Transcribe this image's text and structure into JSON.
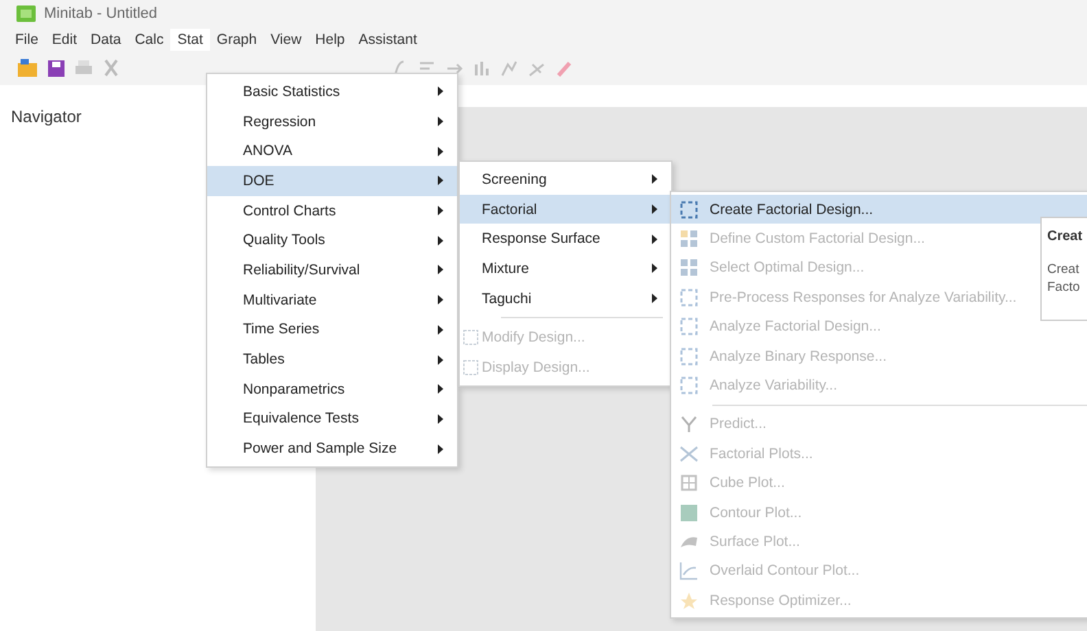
{
  "window": {
    "title": "Minitab - Untitled"
  },
  "menu_bar": [
    {
      "label": "File",
      "selected": false
    },
    {
      "label": "Edit",
      "selected": false
    },
    {
      "label": "Data",
      "selected": false
    },
    {
      "label": "Calc",
      "selected": false
    },
    {
      "label": "Stat",
      "selected": true
    },
    {
      "label": "Graph",
      "selected": false
    },
    {
      "label": "View",
      "selected": false
    },
    {
      "label": "Help",
      "selected": false
    },
    {
      "label": "Assistant",
      "selected": false
    }
  ],
  "navigator": {
    "title": "Navigator"
  },
  "stat_menu": [
    {
      "label": "Basic Statistics",
      "submenu": true,
      "selected": false
    },
    {
      "label": "Regression",
      "submenu": true,
      "selected": false
    },
    {
      "label": "ANOVA",
      "submenu": true,
      "selected": false
    },
    {
      "label": "DOE",
      "submenu": true,
      "selected": true
    },
    {
      "label": "Control Charts",
      "submenu": true,
      "selected": false
    },
    {
      "label": "Quality Tools",
      "submenu": true,
      "selected": false
    },
    {
      "label": "Reliability/Survival",
      "submenu": true,
      "selected": false
    },
    {
      "label": "Multivariate",
      "submenu": true,
      "selected": false
    },
    {
      "label": "Time Series",
      "submenu": true,
      "selected": false
    },
    {
      "label": "Tables",
      "submenu": true,
      "selected": false
    },
    {
      "label": "Nonparametrics",
      "submenu": true,
      "selected": false
    },
    {
      "label": "Equivalence Tests",
      "submenu": true,
      "selected": false
    },
    {
      "label": "Power and Sample Size",
      "submenu": true,
      "selected": false
    }
  ],
  "doe_menu": [
    {
      "label": "Screening",
      "submenu": true,
      "selected": false,
      "disabled": false,
      "separator_before": false
    },
    {
      "label": "Factorial",
      "submenu": true,
      "selected": true,
      "disabled": false,
      "separator_before": false
    },
    {
      "label": "Response Surface",
      "submenu": true,
      "selected": false,
      "disabled": false,
      "separator_before": false
    },
    {
      "label": "Mixture",
      "submenu": true,
      "selected": false,
      "disabled": false,
      "separator_before": false
    },
    {
      "label": "Taguchi",
      "submenu": true,
      "selected": false,
      "disabled": false,
      "separator_before": false
    },
    {
      "label": "Modify Design...",
      "submenu": false,
      "selected": false,
      "disabled": true,
      "separator_before": true
    },
    {
      "label": "Display Design...",
      "submenu": false,
      "selected": false,
      "disabled": true,
      "separator_before": false
    }
  ],
  "factorial_menu": [
    {
      "label": "Create Factorial Design...",
      "selected": true,
      "disabled": false,
      "separator_before": false
    },
    {
      "label": "Define Custom Factorial Design...",
      "selected": false,
      "disabled": true,
      "separator_before": false
    },
    {
      "label": "Select Optimal Design...",
      "selected": false,
      "disabled": true,
      "separator_before": false
    },
    {
      "label": "Pre-Process Responses for Analyze Variability...",
      "selected": false,
      "disabled": true,
      "separator_before": false
    },
    {
      "label": "Analyze Factorial Design...",
      "selected": false,
      "disabled": true,
      "separator_before": false
    },
    {
      "label": "Analyze Binary Response...",
      "selected": false,
      "disabled": true,
      "separator_before": false
    },
    {
      "label": "Analyze Variability...",
      "selected": false,
      "disabled": true,
      "separator_before": false
    },
    {
      "label": "Predict...",
      "selected": false,
      "disabled": true,
      "separator_before": true
    },
    {
      "label": "Factorial Plots...",
      "selected": false,
      "disabled": true,
      "separator_before": false
    },
    {
      "label": "Cube Plot...",
      "selected": false,
      "disabled": true,
      "separator_before": false
    },
    {
      "label": "Contour Plot...",
      "selected": false,
      "disabled": true,
      "separator_before": false
    },
    {
      "label": "Surface Plot...",
      "selected": false,
      "disabled": true,
      "separator_before": false
    },
    {
      "label": "Overlaid Contour Plot...",
      "selected": false,
      "disabled": true,
      "separator_before": false
    },
    {
      "label": "Response Optimizer...",
      "selected": false,
      "disabled": true,
      "separator_before": false
    }
  ],
  "tooltip": {
    "title": "Creat",
    "lines": [
      "Creat",
      "Facto"
    ]
  }
}
